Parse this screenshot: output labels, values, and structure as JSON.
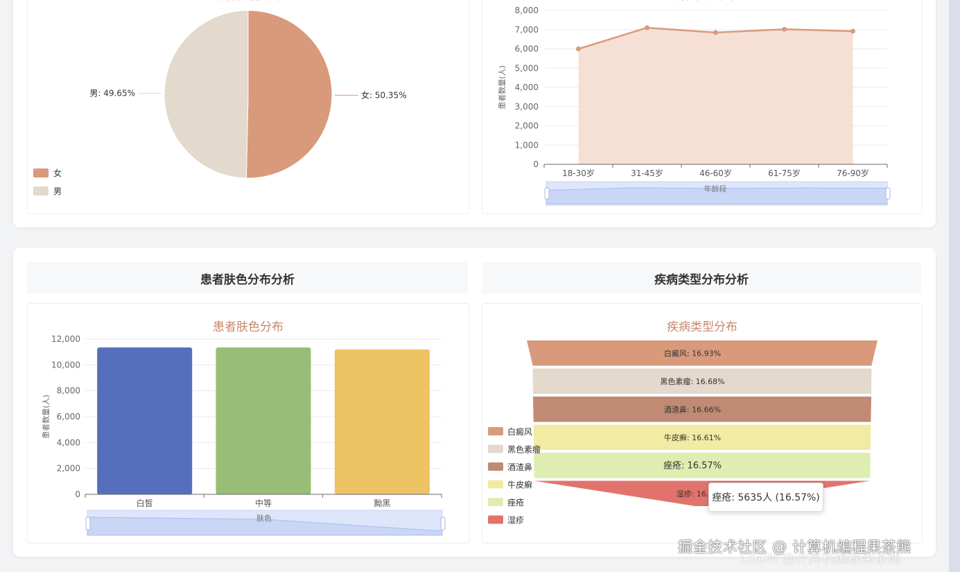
{
  "section_titles": {
    "skin": "患者肤色分布分析",
    "disease": "疾病类型分布分析"
  },
  "chart_data": [
    {
      "type": "pie",
      "title": "患者性别分布",
      "slices": [
        {
          "name": "女",
          "value": 50.35,
          "label": "女: 50.35%",
          "color": "#d99a7b"
        },
        {
          "name": "男",
          "value": 49.65,
          "label": "男: 49.65%",
          "color": "#e3d9cc"
        }
      ],
      "legend": [
        "女",
        "男"
      ],
      "legend_position": "bottom-left"
    },
    {
      "type": "area",
      "title": "患者年龄分布",
      "categories": [
        "18-30岁",
        "31-45岁",
        "46-60岁",
        "61-75岁",
        "76-90岁"
      ],
      "values": [
        6000,
        7100,
        6850,
        7020,
        6920
      ],
      "xlabel": "年龄段",
      "ylabel": "患者数量(人)",
      "ylim": [
        0,
        8000
      ],
      "yticks": [
        "0",
        "1,000",
        "2,000",
        "3,000",
        "4,000",
        "5,000",
        "6,000",
        "7,000",
        "8,000"
      ],
      "color": "#d99a7b",
      "fill": "#f5ddd0"
    },
    {
      "type": "bar",
      "title": "患者肤色分布",
      "categories": [
        "白皙",
        "中等",
        "黝黑"
      ],
      "values": [
        11350,
        11350,
        11200
      ],
      "colors": [
        "#566fbd",
        "#98bd77",
        "#edc363"
      ],
      "xlabel": "肤色",
      "ylabel": "患者数量(人)",
      "ylim": [
        0,
        12000
      ],
      "yticks": [
        "0",
        "2,000",
        "4,000",
        "6,000",
        "8,000",
        "10,000",
        "12,000"
      ]
    },
    {
      "type": "funnel",
      "title": "疾病类型分布",
      "items": [
        {
          "name": "白癜风",
          "value": 16.93,
          "label": "白癜风: 16.93%",
          "color": "#d99a7b"
        },
        {
          "name": "黑色素瘤",
          "value": 16.68,
          "label": "黑色素瘤: 16.68%",
          "color": "#e3d9cc"
        },
        {
          "name": "酒渣鼻",
          "value": 16.66,
          "label": "酒渣鼻: 16.66%",
          "color": "#c08a74"
        },
        {
          "name": "牛皮癣",
          "value": 16.61,
          "label": "牛皮癣: 16.61%",
          "color": "#f1eba3"
        },
        {
          "name": "痤疮",
          "value": 16.57,
          "label": "痤疮: 16.57%",
          "color": "#deedb0"
        },
        {
          "name": "湿疹",
          "value": 16.55,
          "label": "湿疹: 16.",
          "color": "#e2736c"
        }
      ],
      "legend": [
        "白癜风",
        "黑色素瘤",
        "酒渣鼻",
        "牛皮癣",
        "痤疮",
        "湿疹"
      ],
      "legend_position": "left",
      "tooltip": "痤疮: 5635人 (16.57%)"
    }
  ],
  "watermark": {
    "line1": "掘金技术社区 @ 计算机编程果茶熊",
    "line2": "CSDN @计算机编程果茶熊"
  }
}
